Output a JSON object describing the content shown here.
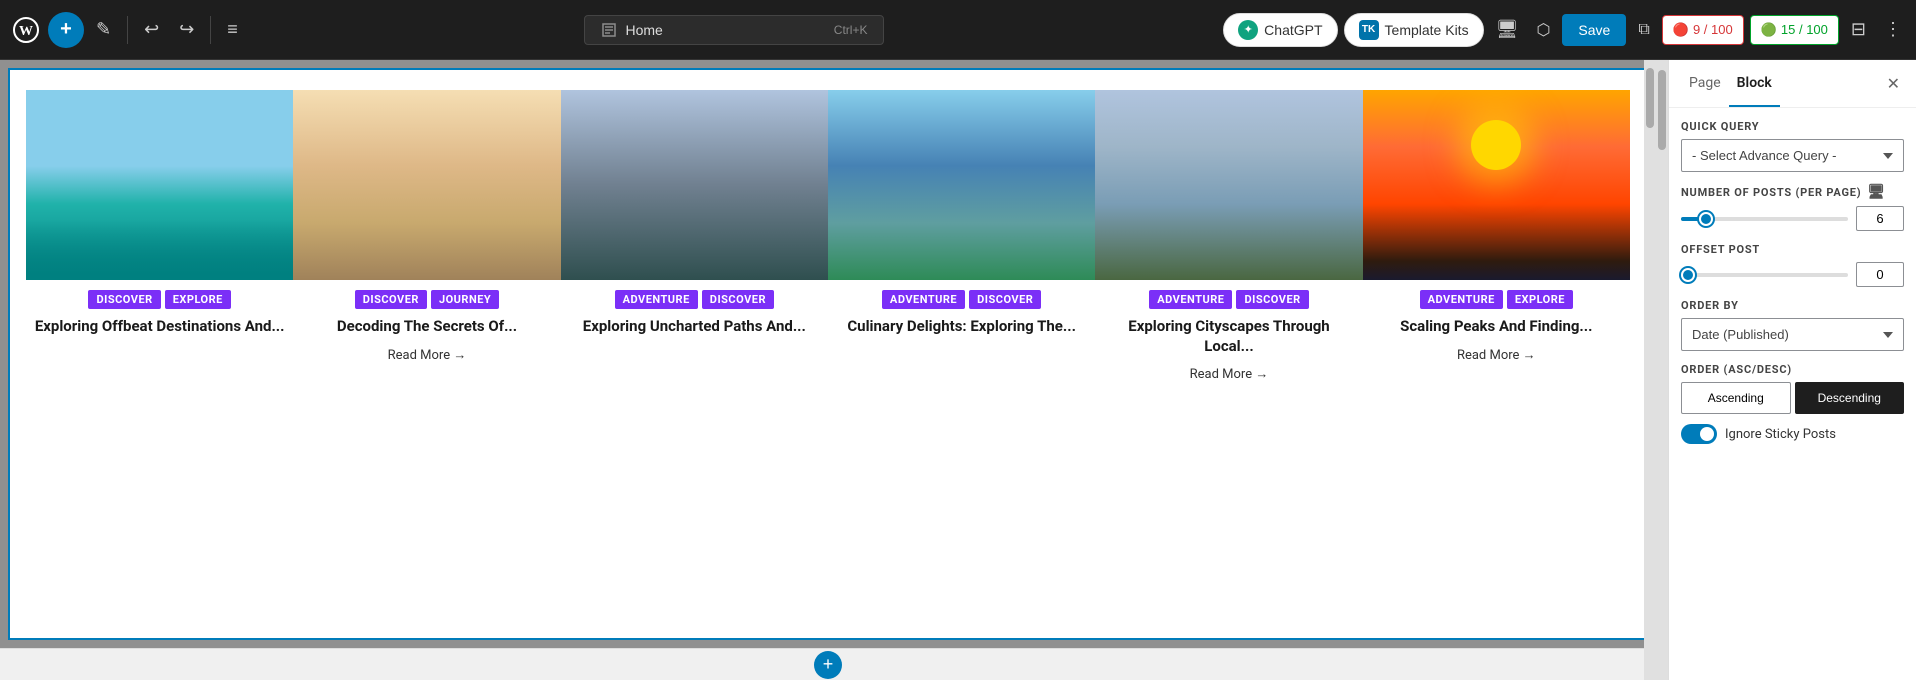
{
  "toolbar": {
    "wp_logo": "W",
    "add_label": "+",
    "edit_icon": "✎",
    "undo_icon": "↩",
    "redo_icon": "↪",
    "list_icon": "≡",
    "home_text": "Home",
    "home_shortcut": "Ctrl+K",
    "chatgpt_label": "ChatGPT",
    "template_kits_label": "Template Kits",
    "view_icon": "⬜",
    "preview_icon": "⬡",
    "save_label": "Save",
    "layout_icon": "⧉",
    "counter1": "🔴 9 / 100",
    "counter2": "🟢 15 / 100",
    "settings_icon": "⋮"
  },
  "panel": {
    "tab_page": "Page",
    "tab_block": "Block",
    "close_icon": "✕",
    "quick_query_label": "QUICK QUERY",
    "quick_query_placeholder": "- Select Advance Query -",
    "quick_query_options": [
      "- Select Advance Query -"
    ],
    "num_posts_label": "NUMBER OF POSTS (PER PAGE)",
    "num_posts_value": "6",
    "num_posts_percent": 15,
    "offset_label": "OFFSET POST",
    "offset_value": "0",
    "offset_percent": 0,
    "order_by_label": "ORDER BY",
    "order_by_value": "Date (Published)",
    "order_asc_desc_label": "ORDER (ASC/DESC)",
    "order_ascending": "Ascending",
    "order_descending": "Descending",
    "ignore_sticky_label": "Ignore Sticky Posts"
  },
  "cards": [
    {
      "tags": [
        "DISCOVER",
        "EXPLORE"
      ],
      "title": "Exploring Offbeat Destinations And...",
      "has_read_more": false,
      "img_class": "img-maldives"
    },
    {
      "tags": [
        "DISCOVER",
        "JOURNEY"
      ],
      "title": "Decoding The Secrets Of...",
      "has_read_more": true,
      "read_more": "Read More →",
      "img_class": "img-pyramid"
    },
    {
      "tags": [
        "ADVENTURE",
        "DISCOVER"
      ],
      "title": "Exploring Uncharted Paths And...",
      "has_read_more": false,
      "img_class": "img-van"
    },
    {
      "tags": [
        "ADVENTURE",
        "DISCOVER"
      ],
      "title": "Culinary Delights: Exploring The...",
      "has_read_more": false,
      "img_class": "img-overwater"
    },
    {
      "tags": [
        "ADVENTURE",
        "DISCOVER"
      ],
      "title": "Exploring Cityscapes Through Local...",
      "has_read_more": true,
      "read_more": "Read More →",
      "img_class": "img-silhouette"
    },
    {
      "tags": [
        "ADVENTURE",
        "EXPLORE"
      ],
      "title": "Scaling Peaks And Finding...",
      "has_read_more": true,
      "read_more": "Read More →",
      "img_class": "img-sunset"
    }
  ]
}
